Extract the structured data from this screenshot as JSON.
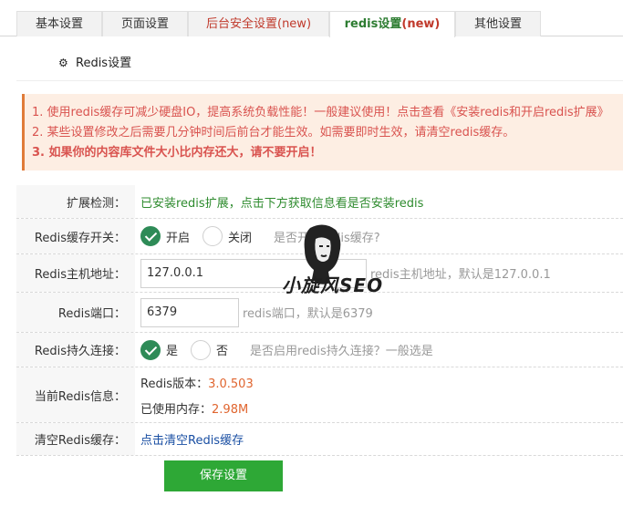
{
  "tabs": [
    {
      "label": "基本设置",
      "badge": ""
    },
    {
      "label": "页面设置",
      "badge": ""
    },
    {
      "label": "后台安全设置",
      "badge": "(new)"
    },
    {
      "label": "redis设置",
      "badge": "(new)"
    },
    {
      "label": "其他设置",
      "badge": ""
    }
  ],
  "section": {
    "title": "Redis设置",
    "icon": "gear-icon"
  },
  "notice": {
    "line1": "1. 使用redis缓存可减少硬盘IO，提高系统负载性能！一般建议使用！点击查看《安装redis和开启redis扩展》",
    "line2": "2. 某些设置修改之后需要几分钟时间后前台才能生效。如需要即时生效，请清空redis缓存。",
    "line3": "3. 如果你的内容库文件大小比内存还大，请不要开启！"
  },
  "form": {
    "ext": {
      "label": "扩展检测：",
      "value": "已安装redis扩展，点击下方获取信息看是否安装redis"
    },
    "cache_switch": {
      "label": "Redis缓存开关：",
      "on": "开启",
      "off": "关闭",
      "hint": "是否开启redis缓存?",
      "selected": "on"
    },
    "host": {
      "label": "Redis主机地址：",
      "value": "127.0.0.1",
      "hint": "redis主机地址，默认是127.0.0.1"
    },
    "port": {
      "label": "Redis端口：",
      "value": "6379",
      "hint": "redis端口，默认是6379"
    },
    "persist": {
      "label": "Redis持久连接：",
      "yes": "是",
      "no": "否",
      "hint": "是否启用redis持久连接？一般选是",
      "selected": "yes"
    },
    "info": {
      "label": "当前Redis信息：",
      "version_label": "Redis版本：",
      "version": "3.0.503",
      "mem_label": "已使用内存：",
      "mem": "2.98M"
    },
    "clear": {
      "label": "清空Redis缓存：",
      "link": "点击清空Redis缓存"
    }
  },
  "save_button": "保存设置",
  "watermark": {
    "text": "小旋风SEO"
  },
  "colors": {
    "accent": "#2ea836",
    "active_tab_text": "#2e7d32",
    "warning_text": "#d9534f",
    "warning_bg": "#fdeee3"
  }
}
